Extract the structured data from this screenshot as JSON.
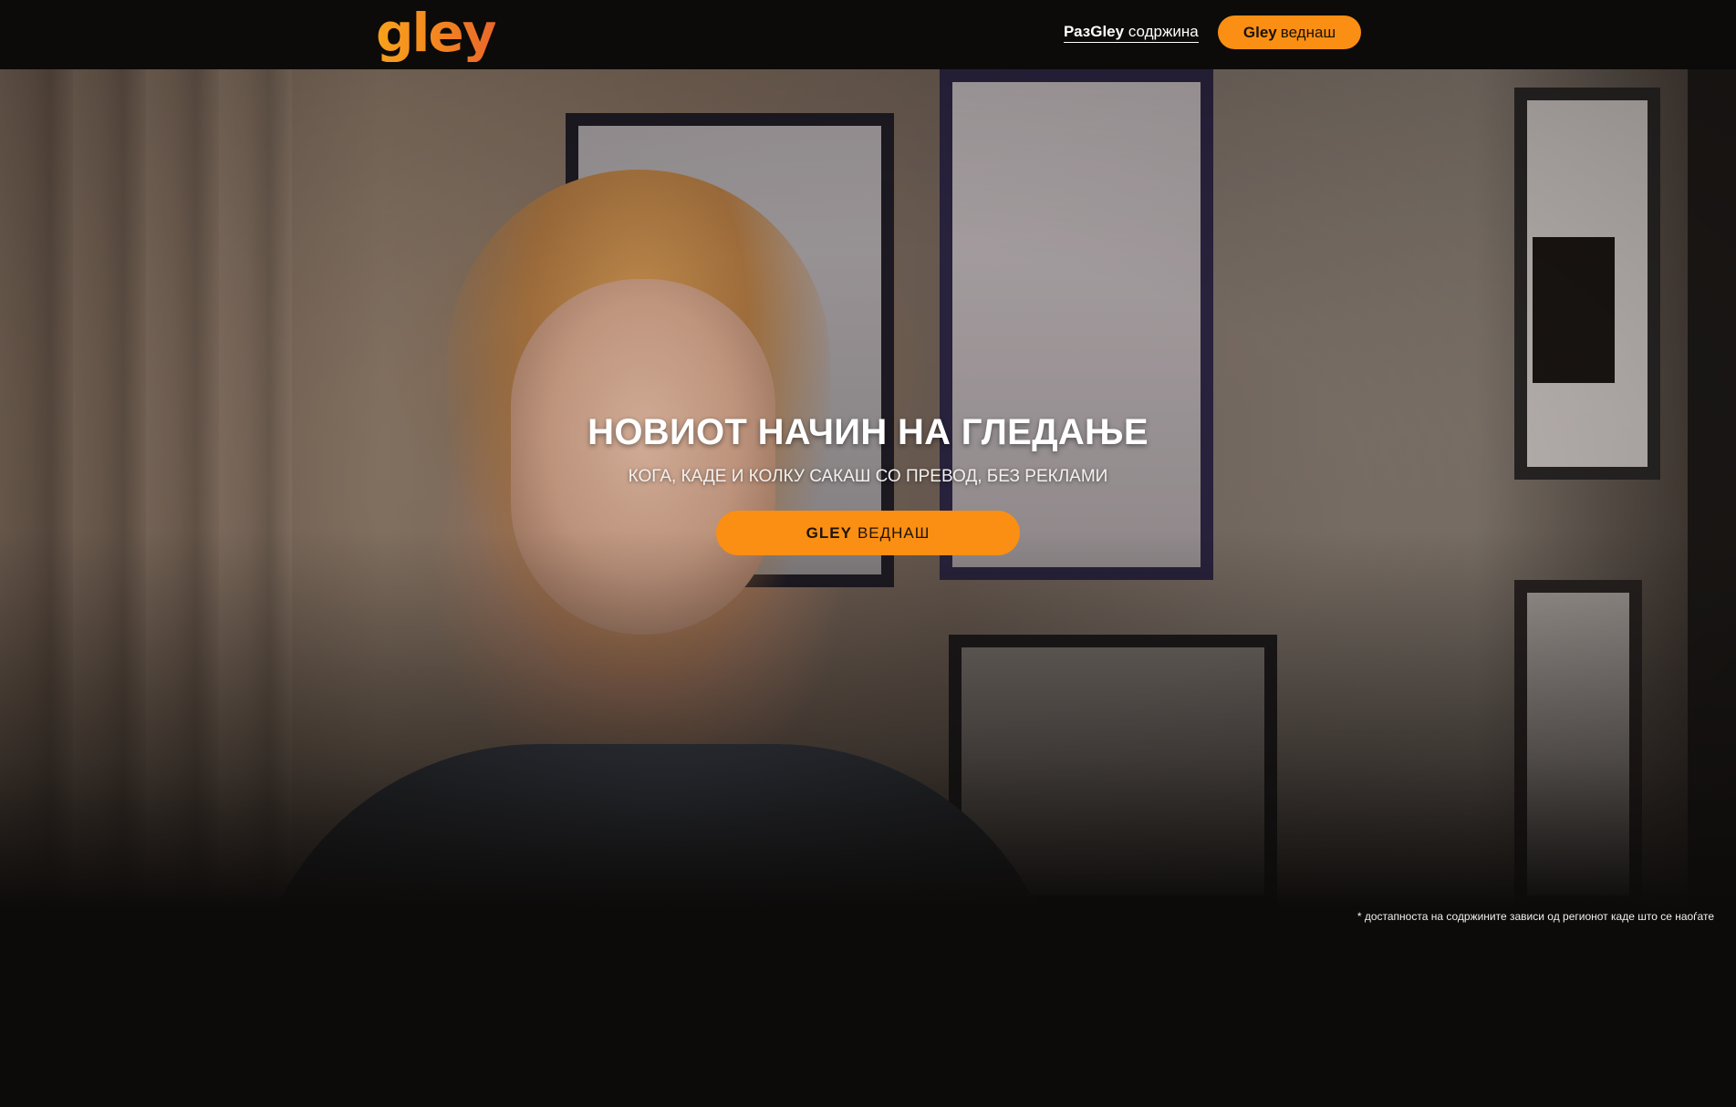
{
  "header": {
    "logo_text": "gley",
    "nav_link_strong": "РазGley",
    "nav_link_rest": "содржина",
    "cta_strong": "Gley",
    "cta_rest": "веднаш"
  },
  "hero": {
    "title": "НОВИОТ НАЧИН НА ГЛЕДАЊЕ",
    "subtitle": "КОГА, КАДЕ И КОЛКУ САКАШ СО ПРЕВОД, БЕЗ РЕКЛАМИ",
    "cta_strong": "GLEY",
    "cta_rest": "ВЕДНАШ"
  },
  "footnote": "* достапноста на содржините зависи од регионот каде што се наоѓате",
  "colors": {
    "accent": "#fb8f13",
    "background": "#0d0b0a",
    "logo_gradient": [
      "#f7a21c",
      "#e8672b"
    ]
  }
}
